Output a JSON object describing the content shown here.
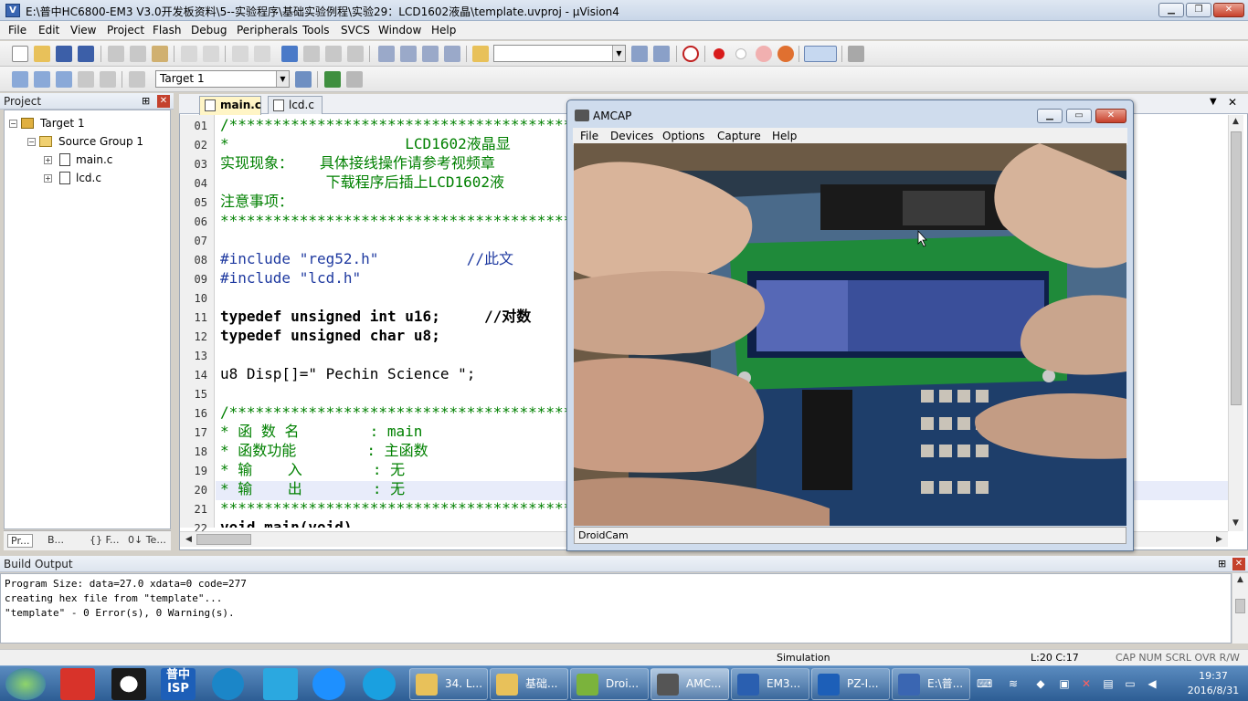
{
  "titlebar": {
    "app_icon": "V",
    "title": "E:\\普中HC6800-EM3 V3.0开发板资料\\5--实验程序\\基础实验例程\\实验29：LCD1602液晶\\template.uvproj - µVision4",
    "min": "▁",
    "max": "❐",
    "close": "✕"
  },
  "menu": [
    "File",
    "Edit",
    "View",
    "Project",
    "Flash",
    "Debug",
    "Peripherals",
    "Tools",
    "SVCS",
    "Window",
    "Help"
  ],
  "toolbar2": {
    "target": "Target 1"
  },
  "project": {
    "title": "Project",
    "pin": "⊞",
    "close": "✕",
    "tree": [
      {
        "label": "Target 1",
        "expander": "−"
      },
      {
        "label": "Source Group 1",
        "expander": "−"
      },
      {
        "label": "main.c",
        "expander": "+"
      },
      {
        "label": "lcd.c",
        "expander": "+"
      }
    ],
    "tabs": [
      "Pr...",
      "B...",
      "{} F...",
      "0↓ Te..."
    ]
  },
  "editor": {
    "tabs": [
      "main.c",
      "lcd.c"
    ],
    "close": "✕",
    "lines": [
      {
        "n": "01",
        "t": "/*******************************************"
      },
      {
        "n": "02",
        "t": "*                    LCD1602液晶显"
      },
      {
        "n": "03",
        "t": "实现现象：   具体接线操作请参考视频章"
      },
      {
        "n": "04",
        "t": "            下载程序后插上LCD1602液"
      },
      {
        "n": "05",
        "t": "注意事项："
      },
      {
        "n": "06",
        "t": "*******************************************"
      },
      {
        "n": "07",
        "t": ""
      },
      {
        "n": "08",
        "t": "#include \"reg52.h\"          //此文"
      },
      {
        "n": "09",
        "t": "#include \"lcd.h\""
      },
      {
        "n": "10",
        "t": ""
      },
      {
        "n": "11",
        "t": "typedef unsigned int u16;     //对数"
      },
      {
        "n": "12",
        "t": "typedef unsigned char u8;"
      },
      {
        "n": "13",
        "t": ""
      },
      {
        "n": "14",
        "t": "u8 Disp[]=\" Pechin Science \";"
      },
      {
        "n": "15",
        "t": ""
      },
      {
        "n": "16",
        "t": "/*******************************************"
      },
      {
        "n": "17",
        "t": "* 函 数 名        : main"
      },
      {
        "n": "18",
        "t": "* 函数功能        : 主函数"
      },
      {
        "n": "19",
        "t": "* 输    入        : 无"
      },
      {
        "n": "20",
        "t": "* 输    出        : 无"
      },
      {
        "n": "21",
        "t": "*******************************************"
      },
      {
        "n": "22",
        "t": "void main(void)"
      }
    ]
  },
  "amcap": {
    "title": "AMCAP",
    "menu": [
      "File",
      "Devices",
      "Options",
      "Capture",
      "Help"
    ],
    "status": "DroidCam",
    "min": "▁",
    "max": "▭",
    "close": "✕"
  },
  "build": {
    "title": "Build Output",
    "lines": [
      "Program Size: data=27.0 xdata=0 code=277",
      "creating hex file from \"template\"...",
      "\"template\" - 0 Error(s), 0 Warning(s)."
    ]
  },
  "statusbar": {
    "mode": "Simulation",
    "pos": "L:20 C:17",
    "flags": "CAP  NUM  SCRL  OVR  R/W"
  },
  "taskbar": {
    "items": [
      {
        "label": "34. L..."
      },
      {
        "label": "基础..."
      },
      {
        "label": "Droi..."
      },
      {
        "label": "AMC..."
      },
      {
        "label": "EM3..."
      },
      {
        "label": "PZ-I..."
      },
      {
        "label": "E:\\普..."
      }
    ],
    "pinned_isp": "普中\nISP",
    "time": "19:37",
    "date": "2016/8/31"
  }
}
